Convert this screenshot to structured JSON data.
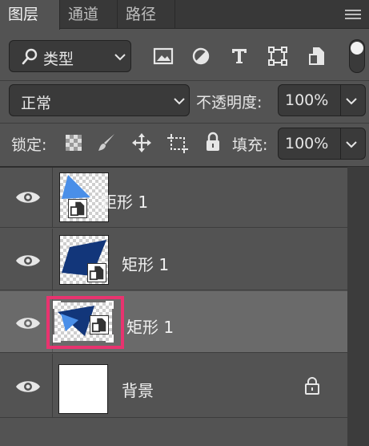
{
  "tabs": [
    {
      "label": "图层"
    },
    {
      "label": "通道"
    },
    {
      "label": "路径"
    }
  ],
  "filter": {
    "kind_label": "类型",
    "icons": [
      "image-filter-icon",
      "adjustment-filter-icon",
      "type-filter-icon",
      "shape-filter-icon",
      "smart-object-filter-icon"
    ]
  },
  "blend": {
    "mode": "正常",
    "opacity_label": "不透明度:",
    "opacity_value": "100%"
  },
  "lock": {
    "label": "锁定:",
    "fill_label": "填充:",
    "fill_value": "100%"
  },
  "layers": [
    {
      "name": "矩形 1",
      "visible": true,
      "smart_object": true,
      "selected": false
    },
    {
      "name": "矩形 1",
      "visible": true,
      "smart_object": true,
      "selected": false
    },
    {
      "name": "矩形 1",
      "visible": true,
      "smart_object": true,
      "selected": true
    },
    {
      "name": "背景",
      "visible": true,
      "smart_object": false,
      "locked": true,
      "selected": false
    }
  ],
  "colors": {
    "panel_bg": "#535353",
    "selected_row": "#6a6a6a",
    "highlight_box": "#e8336f",
    "shape_blue_light": "#4a8fe8",
    "shape_blue_dark": "#12367a"
  }
}
